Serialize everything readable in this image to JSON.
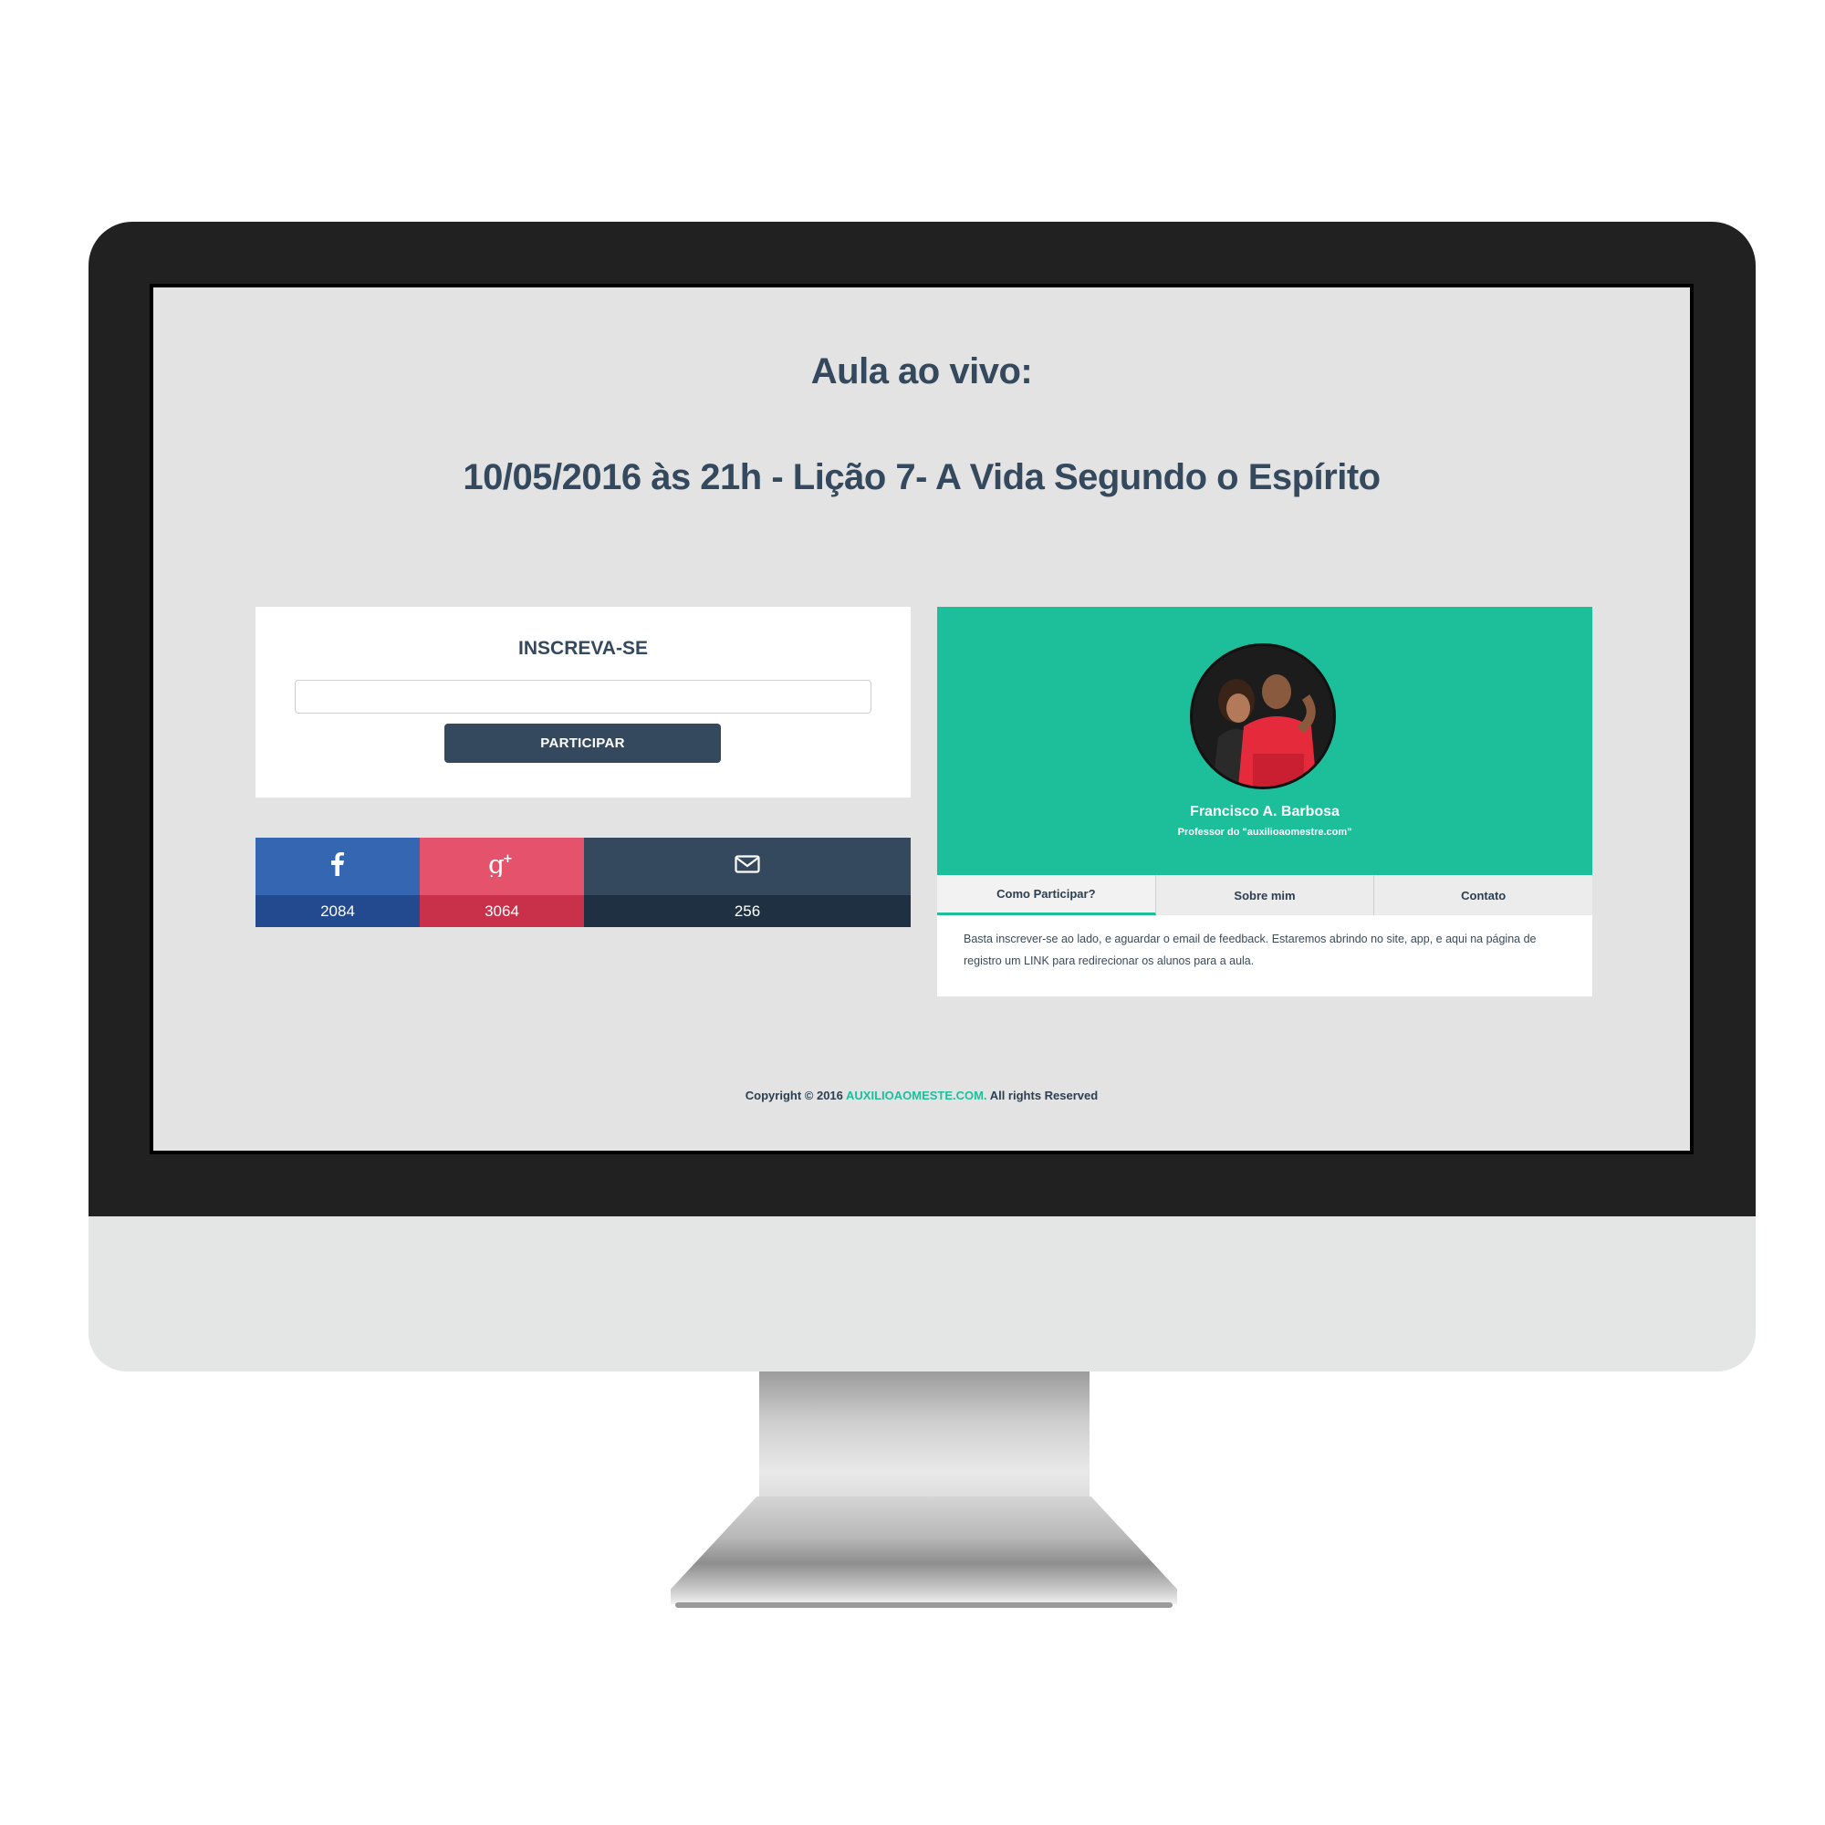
{
  "page": {
    "heading": "Aula ao vivo:",
    "subheading": "10/05/2016 às 21h - Lição 7- A Vida Segundo o Espírito"
  },
  "subscribe": {
    "title": "INSCREVA-SE",
    "email_value": "",
    "email_placeholder": "",
    "button_label": "PARTICIPAR"
  },
  "share": [
    {
      "network": "facebook",
      "icon": "facebook-icon",
      "count": "2084",
      "color": "#3566b1"
    },
    {
      "network": "google-plus",
      "icon": "google-plus-icon",
      "count": "3064",
      "color": "#e5526c"
    },
    {
      "network": "email",
      "icon": "envelope-icon",
      "count": "256",
      "color": "#34495e"
    }
  ],
  "profile": {
    "name": "Francisco A. Barbosa",
    "subtitle": "Professor do \"auxilioaomestre.com\"",
    "accent": "#1dbf9b",
    "tabs": [
      "Como Participar?",
      "Sobre mim",
      "Contato"
    ],
    "active_tab": "Como Participar?",
    "content": "Basta inscrever-se ao lado, e aguardar o email de feedback. Estaremos abrindo no site, app, e aqui na página de registro um LINK para redirecionar os alunos para a aula."
  },
  "footer": {
    "prefix": "Copyright © 2016 ",
    "brand": "AUXILIOAOMESTE.COM.",
    "suffix": " All rights Reserved"
  }
}
